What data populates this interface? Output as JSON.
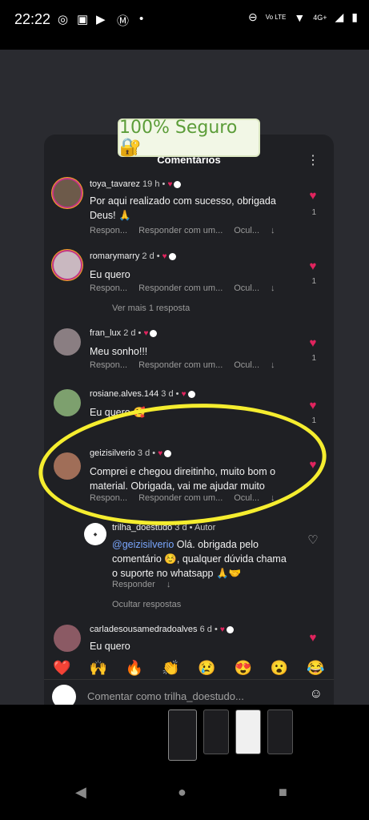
{
  "status": {
    "time": "22:22",
    "network": "4G+",
    "volte": "Vo LTE"
  },
  "banner": {
    "text": "100% Seguro 🔐"
  },
  "sheet": {
    "title": "Comentários"
  },
  "actions": {
    "reply": "Respon...",
    "reply_with": "Responder com um...",
    "hide": "Ocul..."
  },
  "comments": [
    {
      "user": "toya_tavarez",
      "time": "19 h",
      "text1": "Por aqui realizado com sucesso, obrigada",
      "text2": "Deus! 🙏",
      "likes": "1"
    },
    {
      "user": "romarymarry",
      "time": "2 d",
      "text1": "Eu quero",
      "text2": "",
      "likes": "1",
      "more": "Ver mais 1 resposta"
    },
    {
      "user": "fran_lux",
      "time": "2 d",
      "text1": "Meu sonho!!!",
      "text2": "",
      "likes": "1"
    },
    {
      "user": "rosiane.alves.144",
      "time": "3 d",
      "text1": "Eu quero 🥰",
      "text2": "",
      "likes": "1"
    },
    {
      "user": "geizisilverio",
      "time": "3 d",
      "text1": "Comprei e chegou direitinho, muito bom o",
      "text2": "material. Obrigada, vai me ajudar muito",
      "likes": ""
    },
    {
      "user": "carladesousamedradoalves",
      "time": "6 d",
      "text1": "Eu quero",
      "text2": "",
      "likes": ""
    }
  ],
  "reply": {
    "user": "trilha_doestudo",
    "time": "3 d",
    "tag": "Autor",
    "mention": "@geizisilverio",
    "text1": " Olá. obrigada pelo",
    "text2": "comentário ☺️, qualquer dúvida chama",
    "text3": "o suporte no whatsapp 🙏🤝",
    "reply_label": "Responder",
    "hide_replies": "Ocultar respostas"
  },
  "emojis": [
    "❤️",
    "🙌",
    "🔥",
    "👏",
    "😢",
    "😍",
    "😮",
    "😂"
  ],
  "composer": {
    "placeholder": "Comentar como trilha_doestudo..."
  }
}
